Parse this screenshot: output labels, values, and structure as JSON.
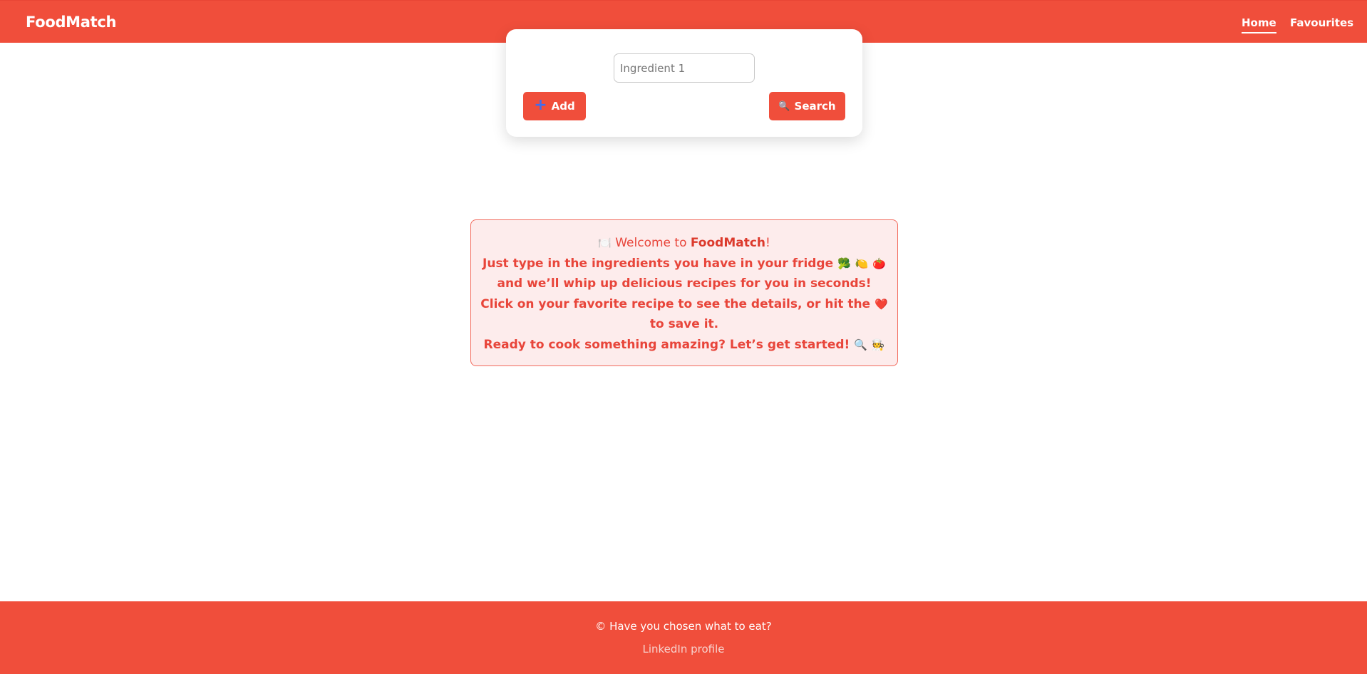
{
  "header": {
    "logo": "FoodMatch",
    "nav": {
      "home": "Home",
      "favourites": "Favourites"
    }
  },
  "search": {
    "ingredient_placeholder": "Ingredient 1",
    "ingredient_value": "",
    "add_label": "Add",
    "search_label": "Search",
    "add_icon": "plus-icon",
    "search_icon": "magnifier-icon"
  },
  "welcome": {
    "line1_prefix": "Welcome to",
    "line1_brand": "FoodMatch",
    "line1_suffix": "!",
    "line2": "Just type in the ingredients you have in your fridge",
    "line3": "and we’ll whip up delicious recipes for you in seconds!",
    "line4": "Click on your favorite recipe to see the details, or hit the",
    "line5": "to save it.",
    "line6": "Ready to cook something amazing? Let’s get started!",
    "emojis": {
      "plate": "🍽️",
      "broccoli": "🥦",
      "lemon": "🍋",
      "tomato": "🍅",
      "heart": "❤️",
      "magnifier": "🔍",
      "cook": "🧑‍🍳"
    }
  },
  "footer": {
    "copyright": "© Have you chosen what to eat?",
    "link": "LinkedIn profile"
  },
  "colors": {
    "brand": "#f04e3b",
    "welcome_bg": "#fdecec",
    "welcome_text": "#e8453a"
  }
}
